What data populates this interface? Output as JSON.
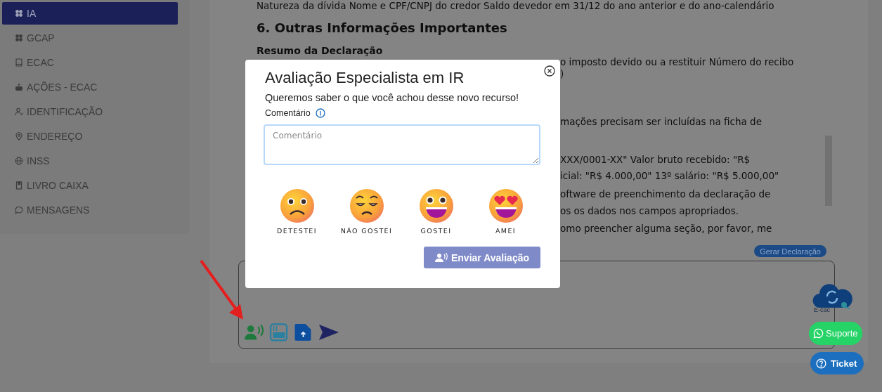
{
  "sidebar": {
    "items": [
      {
        "label": "IA",
        "selected": true
      },
      {
        "label": "GCAP",
        "selected": false
      },
      {
        "label": "ECAC",
        "selected": false
      },
      {
        "label": "AÇÕES - ECAC",
        "selected": false
      },
      {
        "label": "IDENTIFICAÇÃO",
        "selected": false
      },
      {
        "label": "ENDEREÇO",
        "selected": false
      },
      {
        "label": "INSS",
        "selected": false
      },
      {
        "label": "LIVRO CAIXA",
        "selected": false
      },
      {
        "label": "MENSAGENS",
        "selected": false
      }
    ]
  },
  "document": {
    "lines": [
      {
        "kind": "text",
        "text": "Natureza da dívida Nome e CPF/CNPJ do credor Saldo devedor em 31/12 do ano anterior e do ano-calendário"
      },
      {
        "kind": "heading",
        "text": "6. Outras Informações Importantes"
      },
      {
        "kind": "subheading",
        "text": "Resumo da Declaração"
      },
      {
        "kind": "partial",
        "text": "o imposto devido ou a restituir Número do recibo"
      },
      {
        "kind": "partial",
        "text": ")"
      },
      {
        "kind": "partial",
        "text": "mações precisam ser incluídas na ficha de"
      },
      {
        "kind": "partial",
        "text": "XXX/0001-XX\" Valor bruto recebido: \"R$"
      },
      {
        "kind": "partial",
        "text": "icial: \"R$ 4.000,00\" 13º salário: \"R$ 5.000,00\""
      },
      {
        "kind": "partial",
        "text": "oftware de preenchimento da declaração de"
      },
      {
        "kind": "partial",
        "text": "os os dados nos campos apropriados."
      },
      {
        "kind": "partial",
        "text": "omo preencher alguma seção, por favor, me"
      }
    ]
  },
  "generate_button": "Gerar Declaração",
  "ecac_logo": "E-cac",
  "support_button": "Suporte",
  "ticket_button": "Ticket",
  "modal": {
    "title": "Avaliação Especialista em IR",
    "subtitle": "Queremos saber o que você achou desse novo recurso!",
    "field_label": "Comentário",
    "placeholder": "Comentário",
    "reactions": [
      {
        "kind": "sad",
        "label": "DETESTEI"
      },
      {
        "kind": "meh",
        "label": "NÃO GOSTEI"
      },
      {
        "kind": "happy",
        "label": "GOSTEI"
      },
      {
        "kind": "love",
        "label": "AMEI"
      }
    ],
    "submit": "Enviar Avaliação"
  }
}
